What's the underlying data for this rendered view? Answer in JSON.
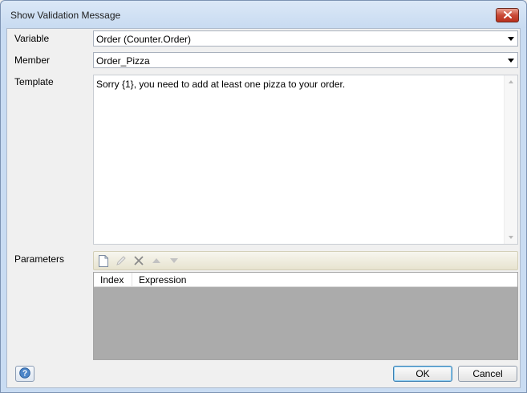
{
  "window": {
    "title": "Show Validation Message"
  },
  "form": {
    "variable_label": "Variable",
    "variable_value": "Order (Counter.Order)",
    "member_label": "Member",
    "member_value": "Order_Pizza",
    "template_label": "Template",
    "template_value": "Sorry {1}, you need to add at least one pizza to your order.",
    "parameters_label": "Parameters"
  },
  "parameters": {
    "toolbar_icons": [
      "new-icon",
      "edit-icon",
      "delete-icon",
      "move-up-icon",
      "move-down-icon"
    ],
    "columns": [
      "Index",
      "Expression"
    ],
    "rows": []
  },
  "footer": {
    "help_icon": "help-icon",
    "ok_label": "OK",
    "cancel_label": "Cancel"
  },
  "colors": {
    "close_button": "#c94a37",
    "grid_background": "#ababab",
    "default_button_border": "#3c7fb1"
  }
}
